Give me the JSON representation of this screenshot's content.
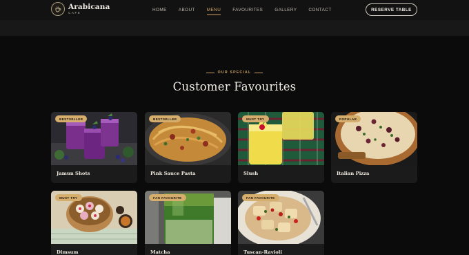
{
  "brand": {
    "name": "Arabicana",
    "sub": "CAFE"
  },
  "nav": {
    "items": [
      {
        "label": "HOME"
      },
      {
        "label": "ABOUT"
      },
      {
        "label": "MENU",
        "active": true
      },
      {
        "label": "FAVOURITES"
      },
      {
        "label": "GALLERY"
      },
      {
        "label": "CONTACT"
      }
    ],
    "cta": "RESERVE TABLE"
  },
  "section": {
    "kicker": "OUR SPECIAL",
    "title": "Customer Favourites"
  },
  "colors": {
    "accent": "#d3a86a",
    "badge": "#d5ad6c",
    "background": "#0b0b0b",
    "card": "#1b1b1b"
  },
  "cards": [
    {
      "name": "Jamun Shots",
      "badge": "BESTSELLER"
    },
    {
      "name": "Pink Sauce Pasta",
      "badge": "BESTSELLER"
    },
    {
      "name": "Slush",
      "badge": "MUST TRY"
    },
    {
      "name": "Italian Pizza",
      "badge": "POPULAR"
    },
    {
      "name": "Dimsum",
      "badge": "MUST TRY"
    },
    {
      "name": "Matcha",
      "badge": "FAN FAVOURITE"
    },
    {
      "name": "Tuscan-Ravioli",
      "badge": "FAN FAVOURITE"
    }
  ]
}
